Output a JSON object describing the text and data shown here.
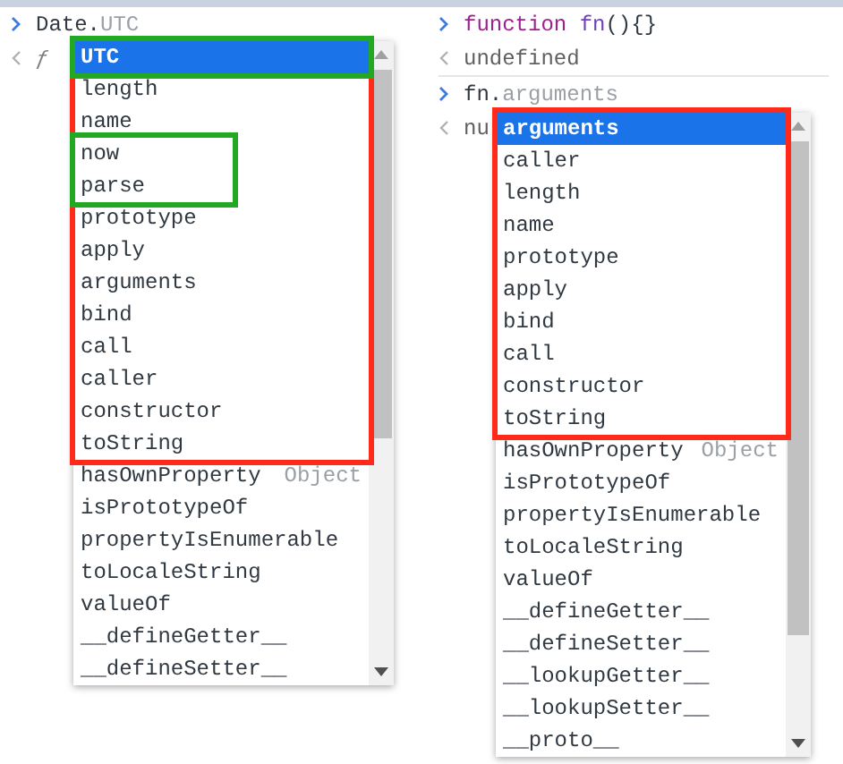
{
  "panes": [
    {
      "lines": [
        {
          "kind": "input",
          "tokens": [
            {
              "text": "Date.",
              "kind": "plain"
            },
            {
              "text": "UTC",
              "kind": "hint"
            }
          ]
        },
        {
          "kind": "output",
          "tokens": [
            {
              "text": "ƒ",
              "kind": "func"
            }
          ]
        }
      ],
      "suggestions": {
        "groups": [
          {
            "kind": "frame",
            "color": "#ff2a1a",
            "groups": [
              {
                "kind": "frame",
                "color": "#22a822",
                "items": [
                  {
                    "label": "UTC",
                    "selected": true
                  }
                ]
              },
              {
                "kind": "plain",
                "items": [
                  {
                    "label": "length",
                    "selected": false
                  },
                  {
                    "label": "name",
                    "selected": false
                  }
                ]
              },
              {
                "kind": "short_frame",
                "color": "#22a822",
                "items": [
                  {
                    "label": "now",
                    "selected": false
                  },
                  {
                    "label": "parse",
                    "selected": false
                  }
                ]
              },
              {
                "kind": "plain",
                "items": [
                  {
                    "label": "prototype",
                    "selected": false
                  },
                  {
                    "label": "apply",
                    "selected": false
                  },
                  {
                    "label": "arguments",
                    "selected": false
                  },
                  {
                    "label": "bind",
                    "selected": false
                  },
                  {
                    "label": "call",
                    "selected": false
                  },
                  {
                    "label": "caller",
                    "selected": false
                  },
                  {
                    "label": "constructor",
                    "selected": false
                  },
                  {
                    "label": "toString",
                    "selected": false
                  }
                ]
              }
            ]
          },
          {
            "kind": "plain",
            "items": [
              {
                "label": "hasOwnProperty",
                "source": "Object",
                "selected": false
              },
              {
                "label": "isPrototypeOf",
                "selected": false
              },
              {
                "label": "propertyIsEnumerable",
                "selected": false
              },
              {
                "label": "toLocaleString",
                "selected": false
              },
              {
                "label": "valueOf",
                "selected": false
              },
              {
                "label": "__defineGetter__",
                "selected": false
              },
              {
                "label": "__defineSetter__",
                "selected": false
              }
            ]
          }
        ]
      }
    },
    {
      "lines": [
        {
          "kind": "input",
          "tokens": [
            {
              "text": "function ",
              "kind": "keyword"
            },
            {
              "text": "fn",
              "kind": "name"
            },
            {
              "text": "(){}",
              "kind": "plain"
            }
          ]
        },
        {
          "kind": "output",
          "tokens": [
            {
              "text": "undefined",
              "kind": "value"
            }
          ]
        },
        {
          "kind": "input",
          "tokens": [
            {
              "text": "fn.",
              "kind": "plain"
            },
            {
              "text": "arguments",
              "kind": "hint"
            }
          ]
        },
        {
          "kind": "output",
          "tokens": [
            {
              "text": "nu",
              "kind": "value"
            }
          ]
        }
      ],
      "suggestions": {
        "groups": [
          {
            "kind": "frame",
            "color": "#ff2a1a",
            "items": [
              {
                "label": "arguments",
                "selected": true
              },
              {
                "label": "caller",
                "selected": false
              },
              {
                "label": "length",
                "selected": false
              },
              {
                "label": "name",
                "selected": false
              },
              {
                "label": "prototype",
                "selected": false
              },
              {
                "label": "apply",
                "selected": false
              },
              {
                "label": "bind",
                "selected": false
              },
              {
                "label": "call",
                "selected": false
              },
              {
                "label": "constructor",
                "selected": false
              },
              {
                "label": "toString",
                "selected": false
              }
            ]
          },
          {
            "kind": "plain",
            "items": [
              {
                "label": "hasOwnProperty",
                "source": "Object",
                "selected": false
              },
              {
                "label": "isPrototypeOf",
                "selected": false
              },
              {
                "label": "propertyIsEnumerable",
                "selected": false
              },
              {
                "label": "toLocaleString",
                "selected": false
              },
              {
                "label": "valueOf",
                "selected": false
              },
              {
                "label": "__defineGetter__",
                "selected": false
              },
              {
                "label": "__defineSetter__",
                "selected": false
              },
              {
                "label": "__lookupGetter__",
                "selected": false
              },
              {
                "label": "__lookupSetter__",
                "selected": false
              },
              {
                "label": "__proto__",
                "selected": false
              }
            ]
          }
        ]
      }
    }
  ]
}
